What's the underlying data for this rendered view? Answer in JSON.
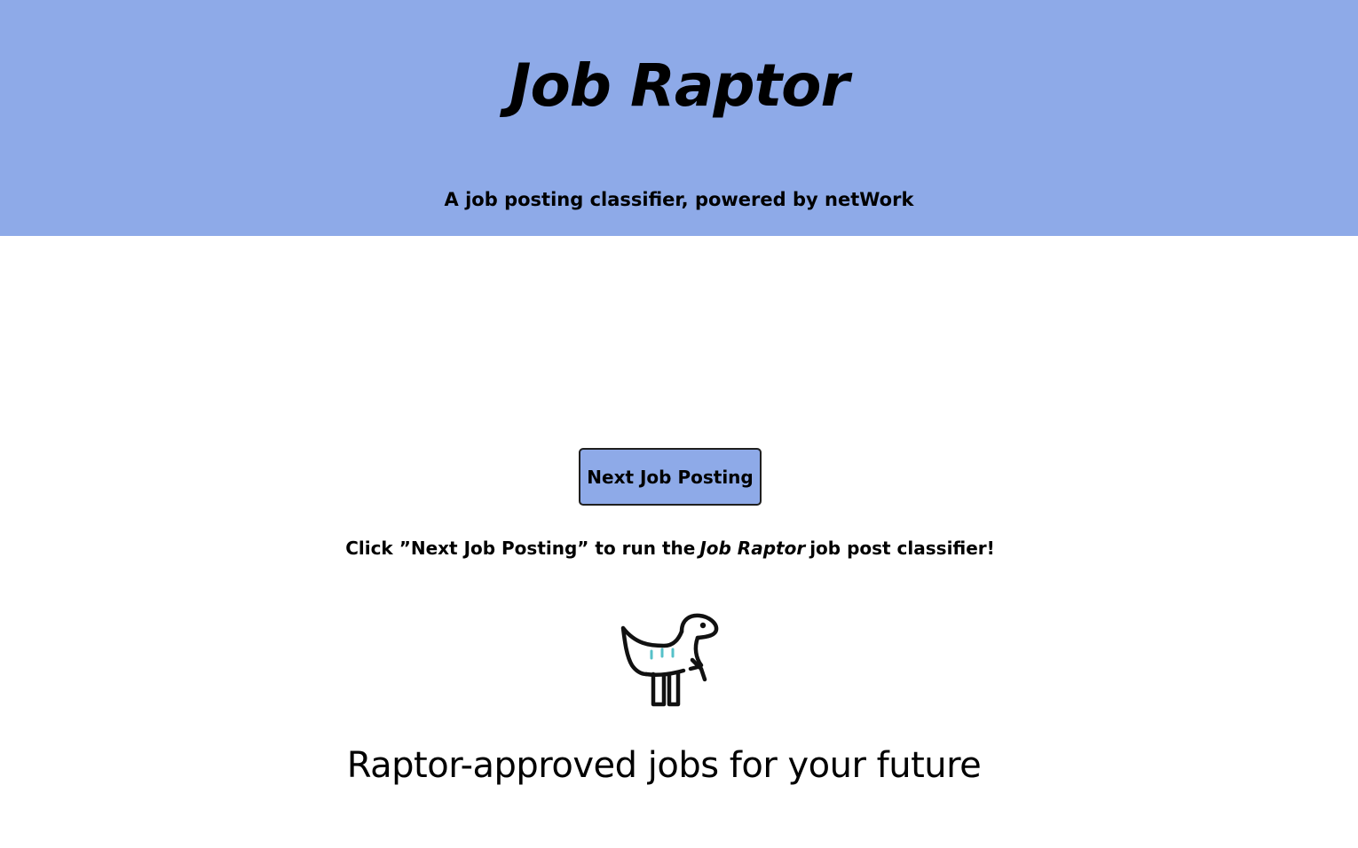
{
  "header": {
    "title": "Job Raptor",
    "subtitle": "A job posting classifier, powered by netWork",
    "background_color": "#8eaae8"
  },
  "main": {
    "next_button_label": "Next Job Posting",
    "instruction": {
      "prefix": "Click ”Next Job Posting” to run the",
      "emphasis": "Job Raptor",
      "suffix": "job post classifier!"
    },
    "mascot_icon": "raptor-dinosaur-icon",
    "tagline": "Raptor-approved jobs for your future"
  },
  "colors": {
    "accent": "#8eaae8",
    "text": "#000000",
    "mascot_stripes": "#56c1c9"
  }
}
